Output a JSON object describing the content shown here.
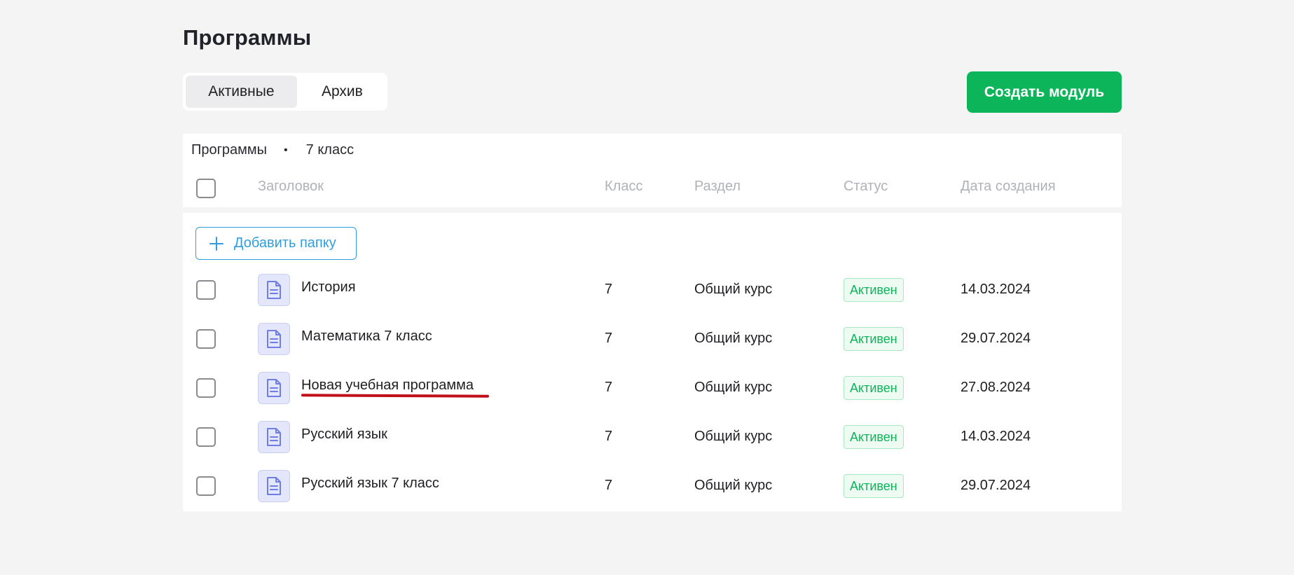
{
  "page": {
    "title": "Программы"
  },
  "tabs": [
    {
      "label": "Активные",
      "active": true
    },
    {
      "label": "Архив",
      "active": false
    }
  ],
  "actions": {
    "create_module": "Создать модуль"
  },
  "breadcrumb": {
    "root": "Программы",
    "separator": "•",
    "current": "7 класс"
  },
  "table": {
    "columns": {
      "title": "Заголовок",
      "grade": "Класс",
      "section": "Раздел",
      "status": "Статус",
      "created": "Дата создания"
    },
    "add_folder_label": "Добавить папку",
    "rows": [
      {
        "title": "История",
        "grade": "7",
        "section": "Общий курс",
        "status": "Активен",
        "created": "14.03.2024"
      },
      {
        "title": "Математика 7 класс",
        "grade": "7",
        "section": "Общий курс",
        "status": "Активен",
        "created": "29.07.2024"
      },
      {
        "title": "Новая учебная программа",
        "grade": "7",
        "section": "Общий курс",
        "status": "Активен",
        "created": "27.08.2024"
      },
      {
        "title": "Русский язык",
        "grade": "7",
        "section": "Общий курс",
        "status": "Активен",
        "created": "14.03.2024"
      },
      {
        "title": "Русский язык 7 класс",
        "grade": "7",
        "section": "Общий курс",
        "status": "Активен",
        "created": "29.07.2024"
      }
    ]
  },
  "colors": {
    "accent_green": "#0db55a",
    "link_blue": "#2f9ee0",
    "annotation_red": "#c0111b",
    "doc_icon": "#6f7de6"
  },
  "icons": {
    "row_icon": "document-icon",
    "add_icon": "plus-icon"
  }
}
